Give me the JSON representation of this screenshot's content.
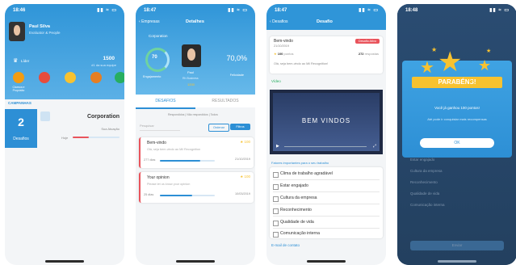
{
  "screens": {
    "s1": {
      "status_time": "18:46",
      "user_name": "Paul Silva",
      "user_sub": "Evaluator & People",
      "level_label": "Líder",
      "points": "1500",
      "ranking_label": "#1 da sua equipe",
      "categories": [
        "Clareza e Propósito",
        "Ambiente",
        "Metas",
        "Equipe",
        "Saúde"
      ],
      "section_label": "CAMPANHAS",
      "badge_number": "2",
      "badge_label": "Desafios",
      "company": "Corporation",
      "company_sub": "Sua Atuação",
      "progress_label": "Hoje"
    },
    "s2": {
      "status_time": "18:47",
      "back_label": "Empresas",
      "title": "Detalhes",
      "company": "Corporation",
      "score": "70",
      "score_label": "Engajamento",
      "percent": "70,0%",
      "percent_label": "Felicidade",
      "person_name": "Paul",
      "person_sub": "Rh Business",
      "person_points": "1200",
      "tab1": "DESAFIOS",
      "tab2": "RESULTADOS",
      "filter_label": "Respondidos | Não respondidos | Todos",
      "search_placeholder": "Pesquisar",
      "btn1": "Ordenar",
      "btn2": "Filtros",
      "cards": [
        {
          "title": "Bem-vindo",
          "pts": "100",
          "desc": "Olá, seja bem-vindo ao Mil Recognition",
          "count": "277 dias",
          "date": "21/10/2019"
        },
        {
          "title": "Your opinion",
          "pts": "100",
          "desc": "Please let us know your opinion",
          "count": "25 dias",
          "date": "10/03/2019"
        }
      ]
    },
    "s3": {
      "status_time": "18:47",
      "back_label": "Desafios",
      "title": "Desafio",
      "card_title": "Bem-vindo",
      "card_date": "21/10/2019",
      "card_tag": "Desafio Ativo",
      "card_pts": "100",
      "card_pts_label": "pontos",
      "card_count": "272",
      "card_count_label": "respostas",
      "card_desc": "Olá, seja bem-vindo ao Mil Recognition!",
      "section": "Vídeo",
      "video_text": "BEM VINDOS",
      "question": "Fatores importantes para o seu trabalho",
      "options": [
        "Clima de trabalho agradável",
        "Estar engajado",
        "Cultura da empresa",
        "Reconhecimento",
        "Qualidade de vida",
        "Comunicação interna"
      ],
      "link": "E-mail de contato"
    },
    "s4": {
      "status_time": "18:48",
      "banner": "PARABÉNS!",
      "line1": "Você já ganhou 100 pontos!",
      "line2": "Até pode ir conquistar mais recompensas",
      "btn": "OK",
      "bg_options": [
        "Estar engajado",
        "Cultura da empresa",
        "Reconhecimento",
        "Qualidade de vida",
        "Comunicação interna"
      ],
      "bg_button": "Enviar"
    }
  },
  "colors": {
    "brand": "#2d8fd5",
    "warn": "#e9545c",
    "gold": "#f7c230"
  }
}
